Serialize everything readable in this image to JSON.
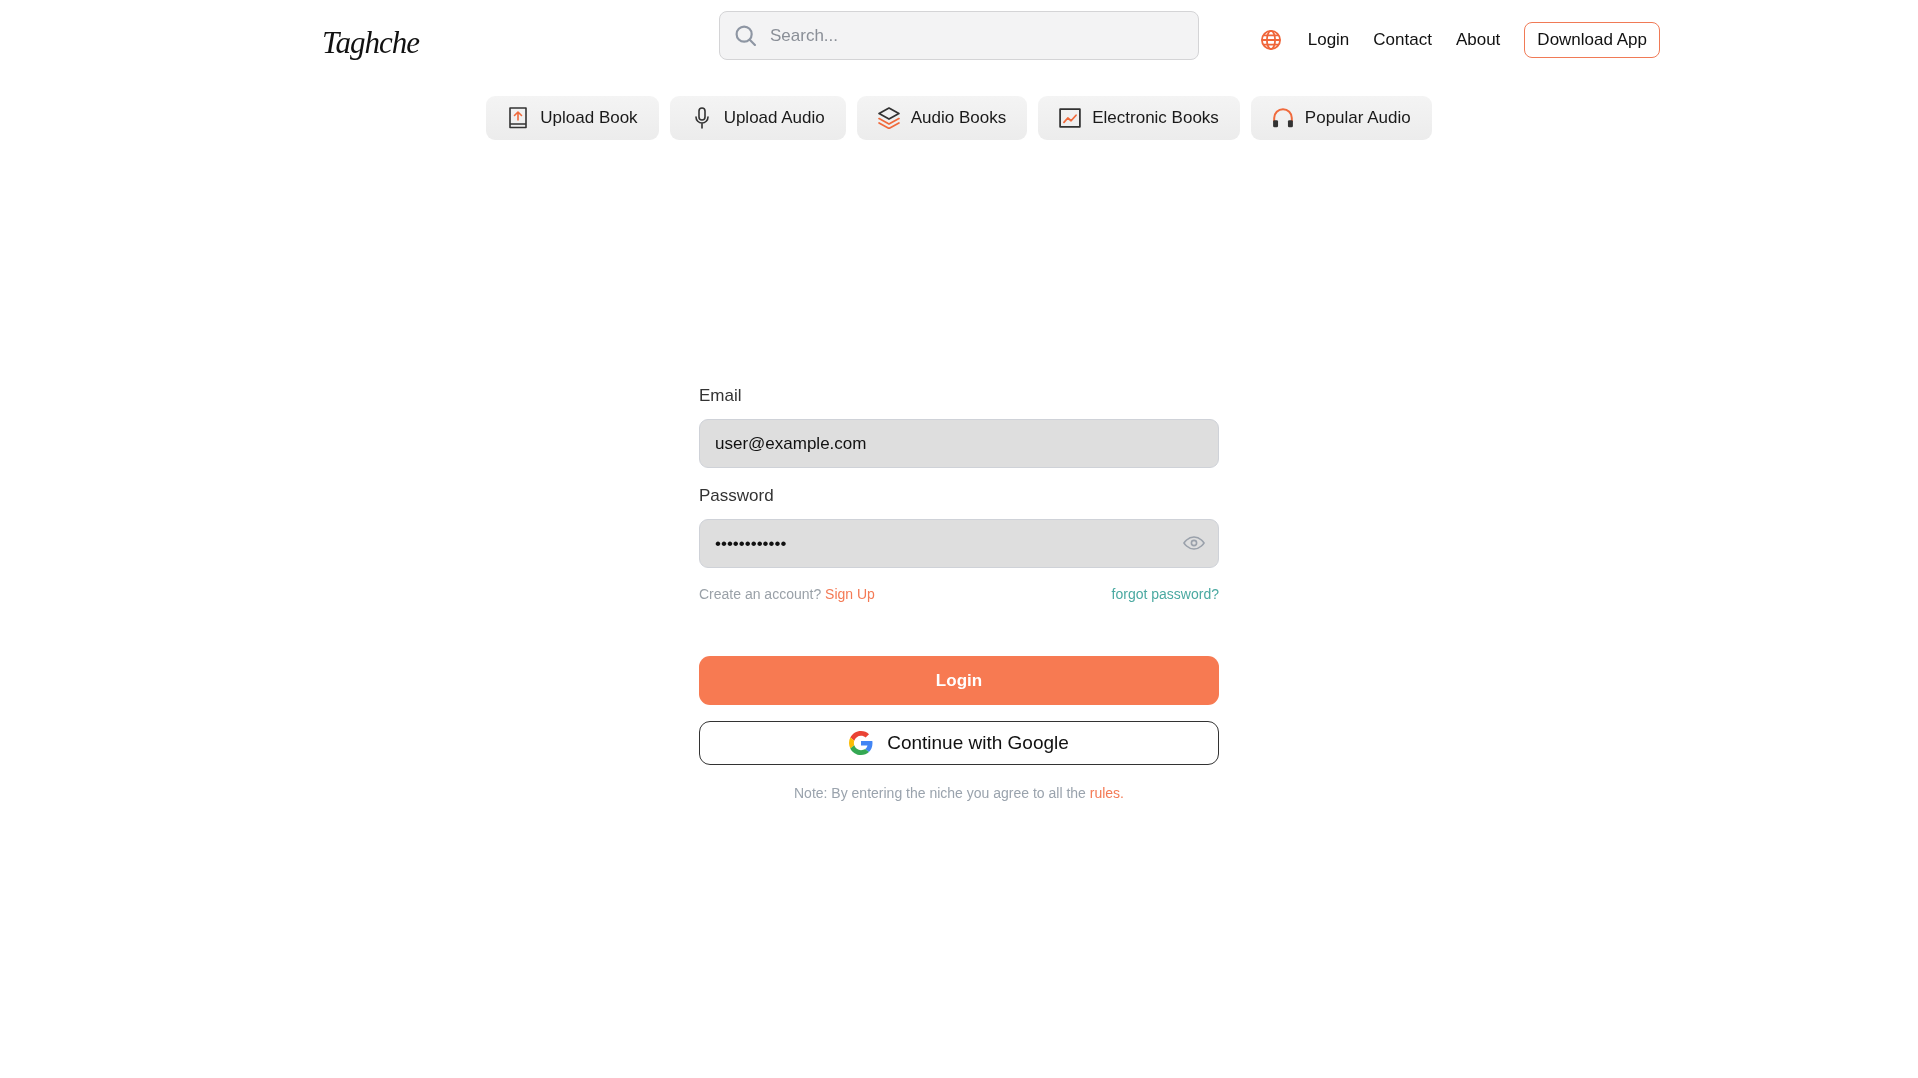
{
  "header": {
    "logo": "Taghche",
    "search": {
      "placeholder": "Search..."
    },
    "nav_links": [
      "Login",
      "Contact",
      "About"
    ],
    "download_button": "Download App"
  },
  "categories": [
    {
      "label": "Upload Book",
      "kind": "upload"
    },
    {
      "label": "Upload Audio",
      "kind": "microphone"
    },
    {
      "label": "Audio Books",
      "kind": "layers"
    },
    {
      "label": "Electronic Books",
      "kind": "picture"
    },
    {
      "label": "Popular Audio",
      "kind": "headphones"
    }
  ],
  "login_form": {
    "email": {
      "label": "Email",
      "value": "user@example.com"
    },
    "password": {
      "label": "Password",
      "value": "••••••••••••"
    },
    "signup_prompt": {
      "text": "Create an account?",
      "link": "Sign Up"
    },
    "forgot_password": "forgot password?",
    "login_button": "Login",
    "google_button": "Continue with Google",
    "note": {
      "text": "Note: By entering the niche you agree to all the",
      "link": "rules."
    }
  }
}
